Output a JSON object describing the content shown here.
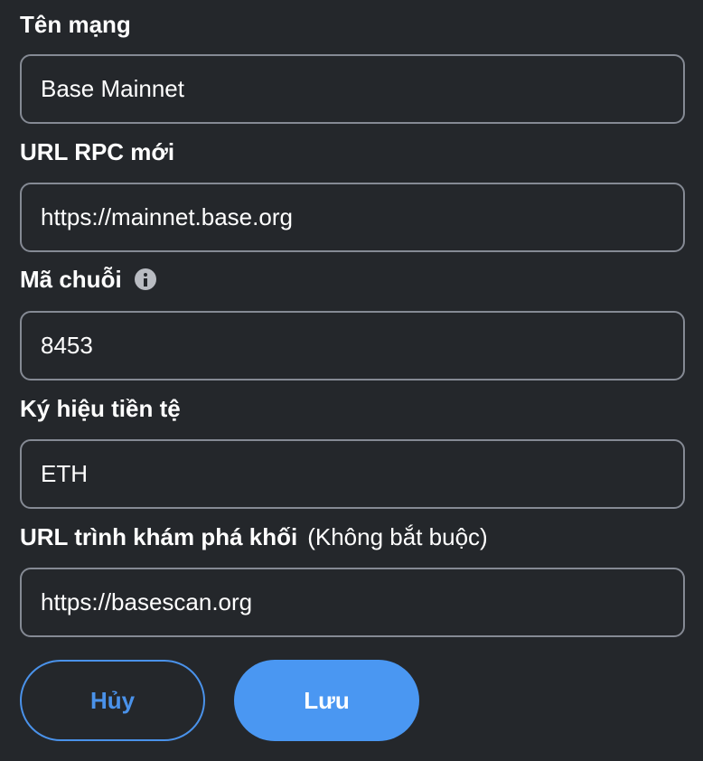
{
  "form": {
    "network_name": {
      "label": "Tên mạng",
      "value": "Base Mainnet"
    },
    "rpc_url": {
      "label": "URL RPC mới",
      "value": "https://mainnet.base.org"
    },
    "chain_id": {
      "label": "Mã chuỗi",
      "icon": "info-icon",
      "value": "8453"
    },
    "currency_symbol": {
      "label": "Ký hiệu tiền tệ",
      "value": "ETH"
    },
    "block_explorer_url": {
      "label": "URL trình khám phá khối",
      "optional_note": "(Không bắt buộc)",
      "value": "https://basescan.org"
    }
  },
  "buttons": {
    "cancel_label": "Hủy",
    "save_label": "Lưu"
  },
  "colors": {
    "background": "#24272b",
    "field_border": "#858a94",
    "primary": "#4a97f2"
  }
}
